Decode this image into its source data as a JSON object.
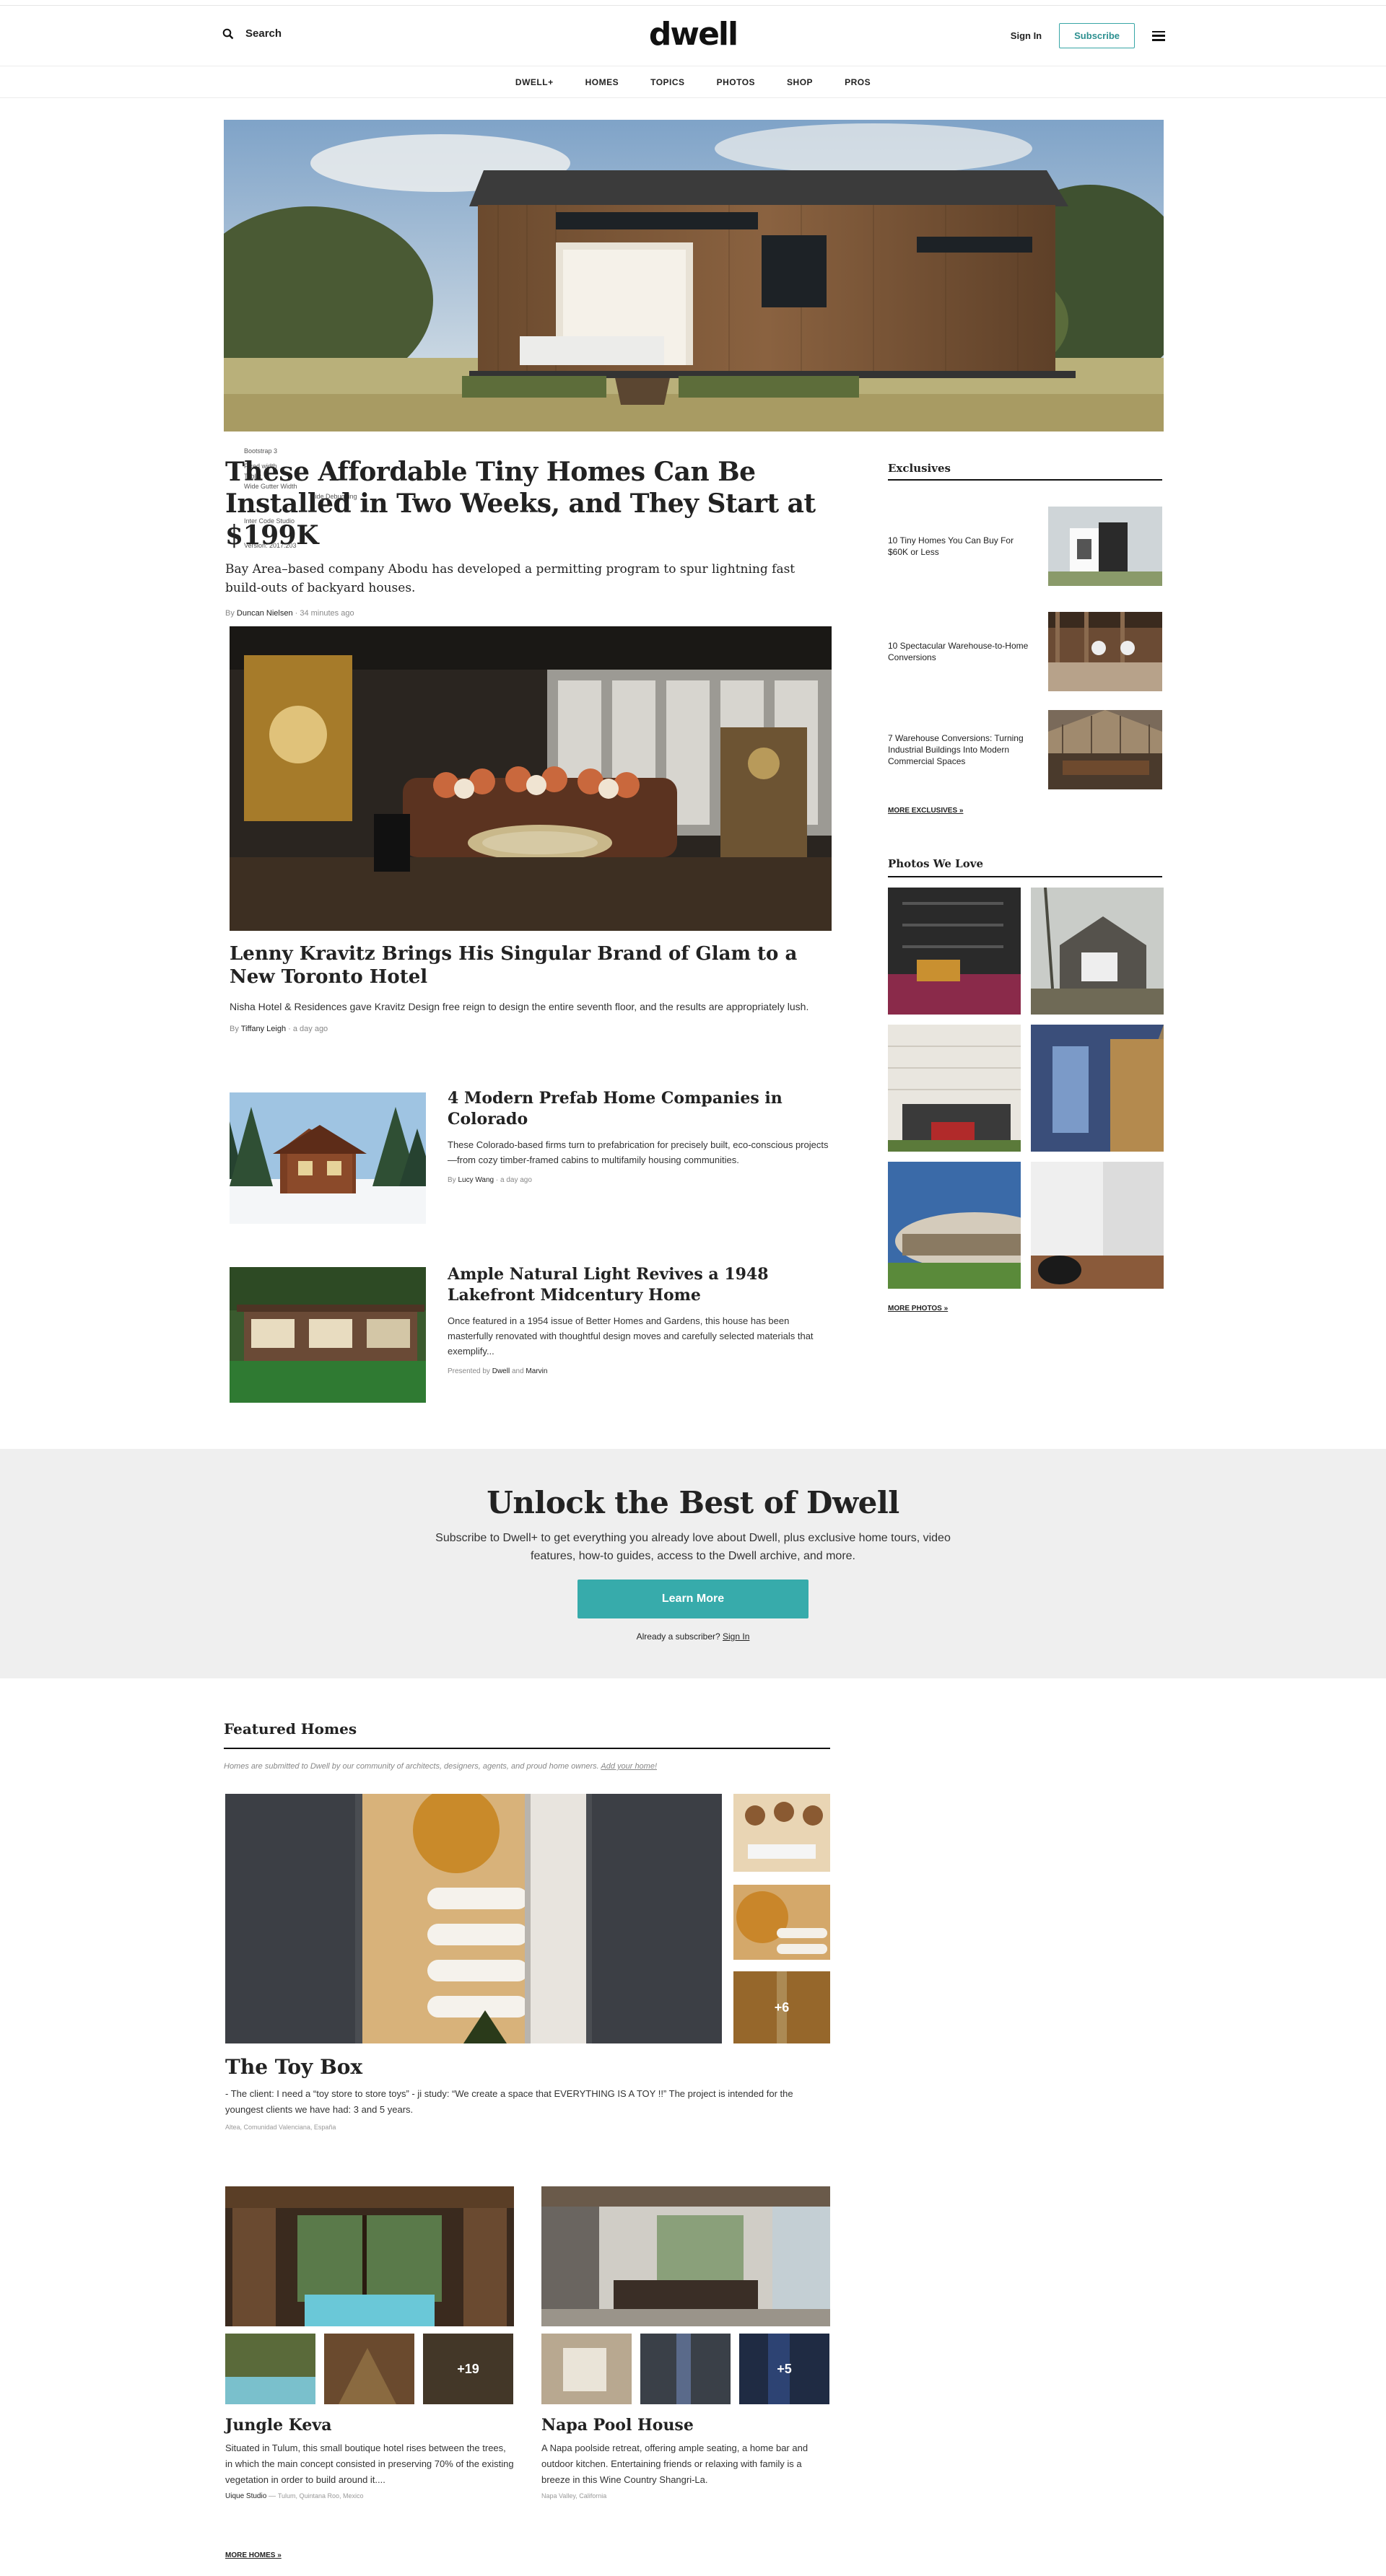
{
  "header": {
    "search_label": "Search",
    "logo": "dwell",
    "signin_label": "Sign In",
    "subscribe_label": "Subscribe"
  },
  "nav": [
    "DWELL+",
    "HOMES",
    "TOPICS",
    "PHOTOS",
    "SHOP",
    "PROS"
  ],
  "debug_overlay": [
    "Bootstrap 3",
    "Fixed width",
    "Tablet",
    "Wide Gutter Width",
    "Hide Debugging",
    "Inter Code Studio",
    "Version: 2017.203"
  ],
  "lead": {
    "title": "These Affordable Tiny Homes Can Be Installed in Two Weeks, and They Start at $199K",
    "dek": "Bay Area–based company Abodu has developed a permitting program to spur lightning fast build-outs of backyard houses.",
    "byline_prefix": "By",
    "author": "Duncan Nielsen",
    "time": "34 minutes ago"
  },
  "story2": {
    "title": "Lenny Kravitz Brings His Singular Brand of Glam to a New Toronto Hotel",
    "dek": "Nisha Hotel & Residences gave Kravitz Design free reign to design the entire seventh floor, and the results are appropriately lush.",
    "byline_prefix": "By",
    "author": "Tiffany Leigh",
    "time": "a day ago"
  },
  "story3": {
    "title": "4 Modern Prefab Home Companies in Colorado",
    "dek": "These Colorado-based firms turn to prefabrication for precisely built, eco-conscious projects—from cozy timber-framed cabins to multifamily housing communities.",
    "byline_prefix": "By",
    "author": "Lucy Wang",
    "time": "a day ago"
  },
  "story4": {
    "title": "Ample Natural Light Revives a 1948 Lakefront Midcentury Home",
    "dek": "Once featured in a 1954 issue of Better Homes and Gardens, this house has been masterfully renovated with thoughtful design moves and carefully selected materials that exemplify...",
    "presented_prefix": "Presented by",
    "sponsor1": "Dwell",
    "and": "and",
    "sponsor2": "Marvin"
  },
  "exclusives": {
    "heading": "Exclusives",
    "items": [
      "10 Tiny Homes You Can Buy For $60K or Less",
      "10 Spectacular Warehouse-to-Home Conversions",
      "7 Warehouse Conversions: Turning Industrial Buildings Into Modern Commercial Spaces"
    ],
    "more": "MORE EXCLUSIVES »"
  },
  "photos": {
    "heading": "Photos We Love",
    "more": "MORE PHOTOS »"
  },
  "cta": {
    "title": "Unlock the Best of Dwell",
    "body": "Subscribe to Dwell+ to get everything you already love about Dwell, plus exclusive home tours, video features, how-to guides, access to the Dwell archive, and more.",
    "button": "Learn More",
    "already": "Already a subscriber?",
    "signin": "Sign In"
  },
  "featured": {
    "heading": "Featured Homes",
    "note": "Homes are submitted to Dwell by our community of architects, designers, agents, and proud home owners.",
    "note_link": "Add your home!",
    "main_more": "+6",
    "main_title": "The Toy Box",
    "main_dek": "- The client: I need a “toy store to store toys” - ji study: “We create a space that EVERYTHING IS A TOY !!” The project is intended for the youngest clients we have had: 3 and 5 years.",
    "main_location": "Altea, Comunidad Valenciana, España",
    "home2": {
      "more": "+19",
      "title": "Jungle Keva",
      "dek": "Situated in Tulum, this small boutique hotel rises between the trees, in which the main concept consisted in preserving 70% of the existing vegetation in order to build around it....",
      "studio": "Uique Studio",
      "location": "Tulum, Quintana Roo, Mexico"
    },
    "home3": {
      "more": "+5",
      "title": "Napa Pool House",
      "dek": "A Napa poolside retreat, offering ample seating, a home bar and outdoor kitchen. Entertaining friends or relaxing with family is a breeze in this Wine Country Shangri-La.",
      "location": "Napa Valley, California"
    },
    "more": "MORE HOMES »"
  },
  "colors": {
    "accent": "#37abab",
    "text": "#222222",
    "gray_bg": "#efefef"
  }
}
